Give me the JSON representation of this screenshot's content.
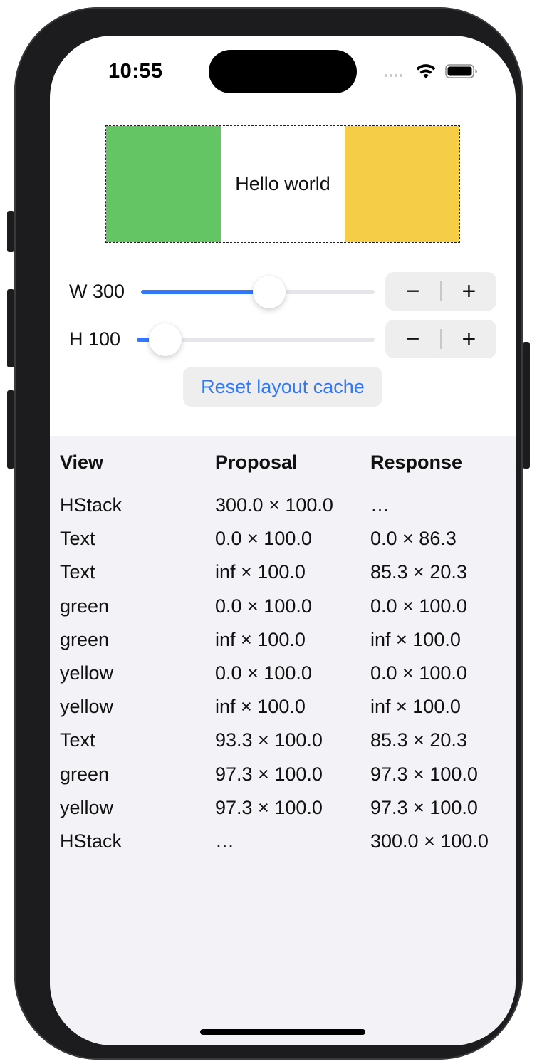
{
  "status_bar": {
    "time": "10:55"
  },
  "preview": {
    "label": "Hello world",
    "colors": {
      "green": "#63c564",
      "yellow": "#f6cd46"
    }
  },
  "controls": {
    "width": {
      "label": "W 300",
      "value_fraction": 0.55
    },
    "height": {
      "label": "H 100",
      "value_fraction": 0.12
    },
    "stepper_minus": "−",
    "stepper_plus": "+",
    "reset_label": "Reset layout cache"
  },
  "accent_color": "#3478f6",
  "table": {
    "headers": [
      "View",
      "Proposal",
      "Response"
    ],
    "rows": [
      [
        "HStack",
        "300.0 × 100.0",
        "…"
      ],
      [
        "Text",
        "0.0 × 100.0",
        "0.0 × 86.3"
      ],
      [
        "Text",
        "inf × 100.0",
        "85.3 × 20.3"
      ],
      [
        "green",
        "0.0 × 100.0",
        "0.0 × 100.0"
      ],
      [
        "green",
        "inf × 100.0",
        "inf × 100.0"
      ],
      [
        "yellow",
        "0.0 × 100.0",
        "0.0 × 100.0"
      ],
      [
        "yellow",
        "inf × 100.0",
        "inf × 100.0"
      ],
      [
        "Text",
        "93.3 × 100.0",
        "85.3 × 20.3"
      ],
      [
        "green",
        "97.3 × 100.0",
        "97.3 × 100.0"
      ],
      [
        "yellow",
        "97.3 × 100.0",
        "97.3 × 100.0"
      ],
      [
        "HStack",
        "…",
        "300.0 × 100.0"
      ]
    ]
  }
}
